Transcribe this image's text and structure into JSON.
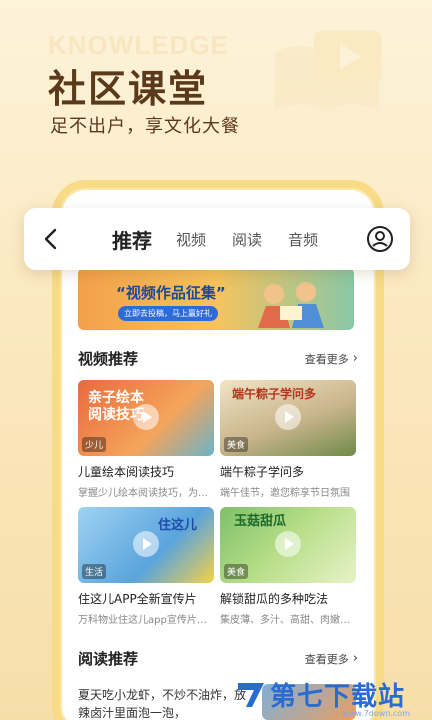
{
  "hero": {
    "bg_word": "KNOWLEDGE",
    "title": "社区课堂",
    "subtitle": "足不出户，享文化大餐"
  },
  "nav": {
    "tabs": [
      "推荐",
      "视频",
      "阅读",
      "音频"
    ],
    "active_tab": "推荐"
  },
  "banner": {
    "title": "“视频作品征集”",
    "pill": "立即去投稿，马上赢好礼"
  },
  "video_section": {
    "title": "视频推荐",
    "more": "查看更多",
    "cards": [
      {
        "thumb_title": "亲子绘本阅读技巧",
        "tag": "少儿",
        "title": "儿童绘本阅读技巧",
        "desc": "掌握少儿绘本阅读技巧，为将..."
      },
      {
        "thumb_title": "端午粽子学问多",
        "tag": "美食",
        "title": "端午粽子学问多",
        "desc": "端午佳节，邀您粽享节日氛围"
      },
      {
        "thumb_title": "住这儿",
        "tag": "生活",
        "title": "住这儿APP全新宣传片",
        "desc": "万科物业住这儿app宣传片，..."
      },
      {
        "thumb_title": "玉菇甜瓜",
        "tag": "美食",
        "title": "解锁甜瓜的多种吃法",
        "desc": "集皮薄、多汁、高甜、肉嫩、..."
      }
    ]
  },
  "read_section": {
    "title": "阅读推荐",
    "more": "查看更多",
    "item_text": "夏天吃小龙虾，不炒不油炸，放辣卤汁里面泡一泡，"
  },
  "watermark": {
    "text": "第七下载站",
    "url": "www.7down.com"
  },
  "colors": {
    "accent": "#f8db86",
    "title_brown": "#5a3a1a",
    "watermark_blue": "#2a6bd1"
  }
}
